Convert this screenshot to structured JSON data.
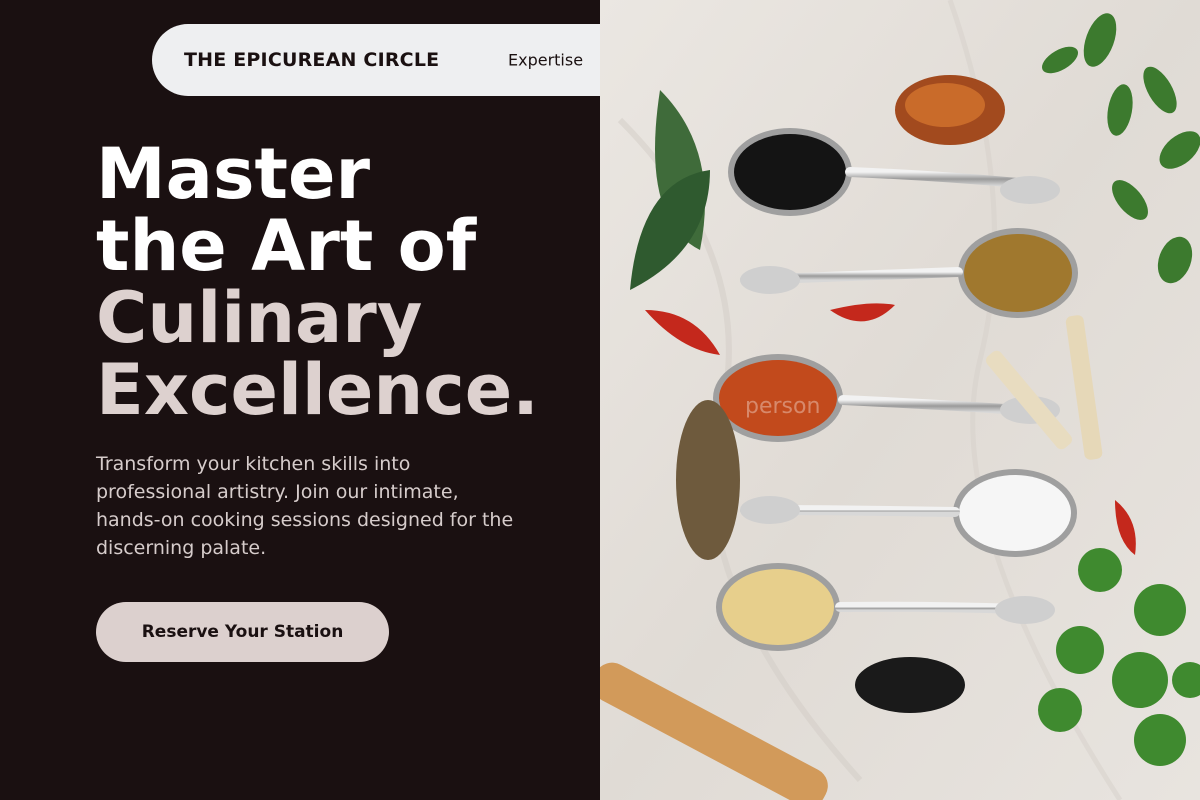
{
  "nav": {
    "brand": "THE EPICUREAN CIRCLE",
    "links": [
      "Expertise"
    ]
  },
  "hero": {
    "headline_lines": [
      "Master",
      "the Art of",
      "Culinary",
      "Excellence."
    ],
    "intro": "Transform your kitchen skills into professional artistry. Join our intimate, hands-on cooking sessions designed for the discerning palate.",
    "cta_label": "Reserve Your Station"
  },
  "image": {
    "watermark": "person"
  },
  "colors": {
    "background": "#1a1011",
    "nav_bg": "#eeeff1",
    "accent": "#dcd0ce",
    "headline_primary": "#ffffff",
    "headline_secondary": "#ddd1cf"
  }
}
